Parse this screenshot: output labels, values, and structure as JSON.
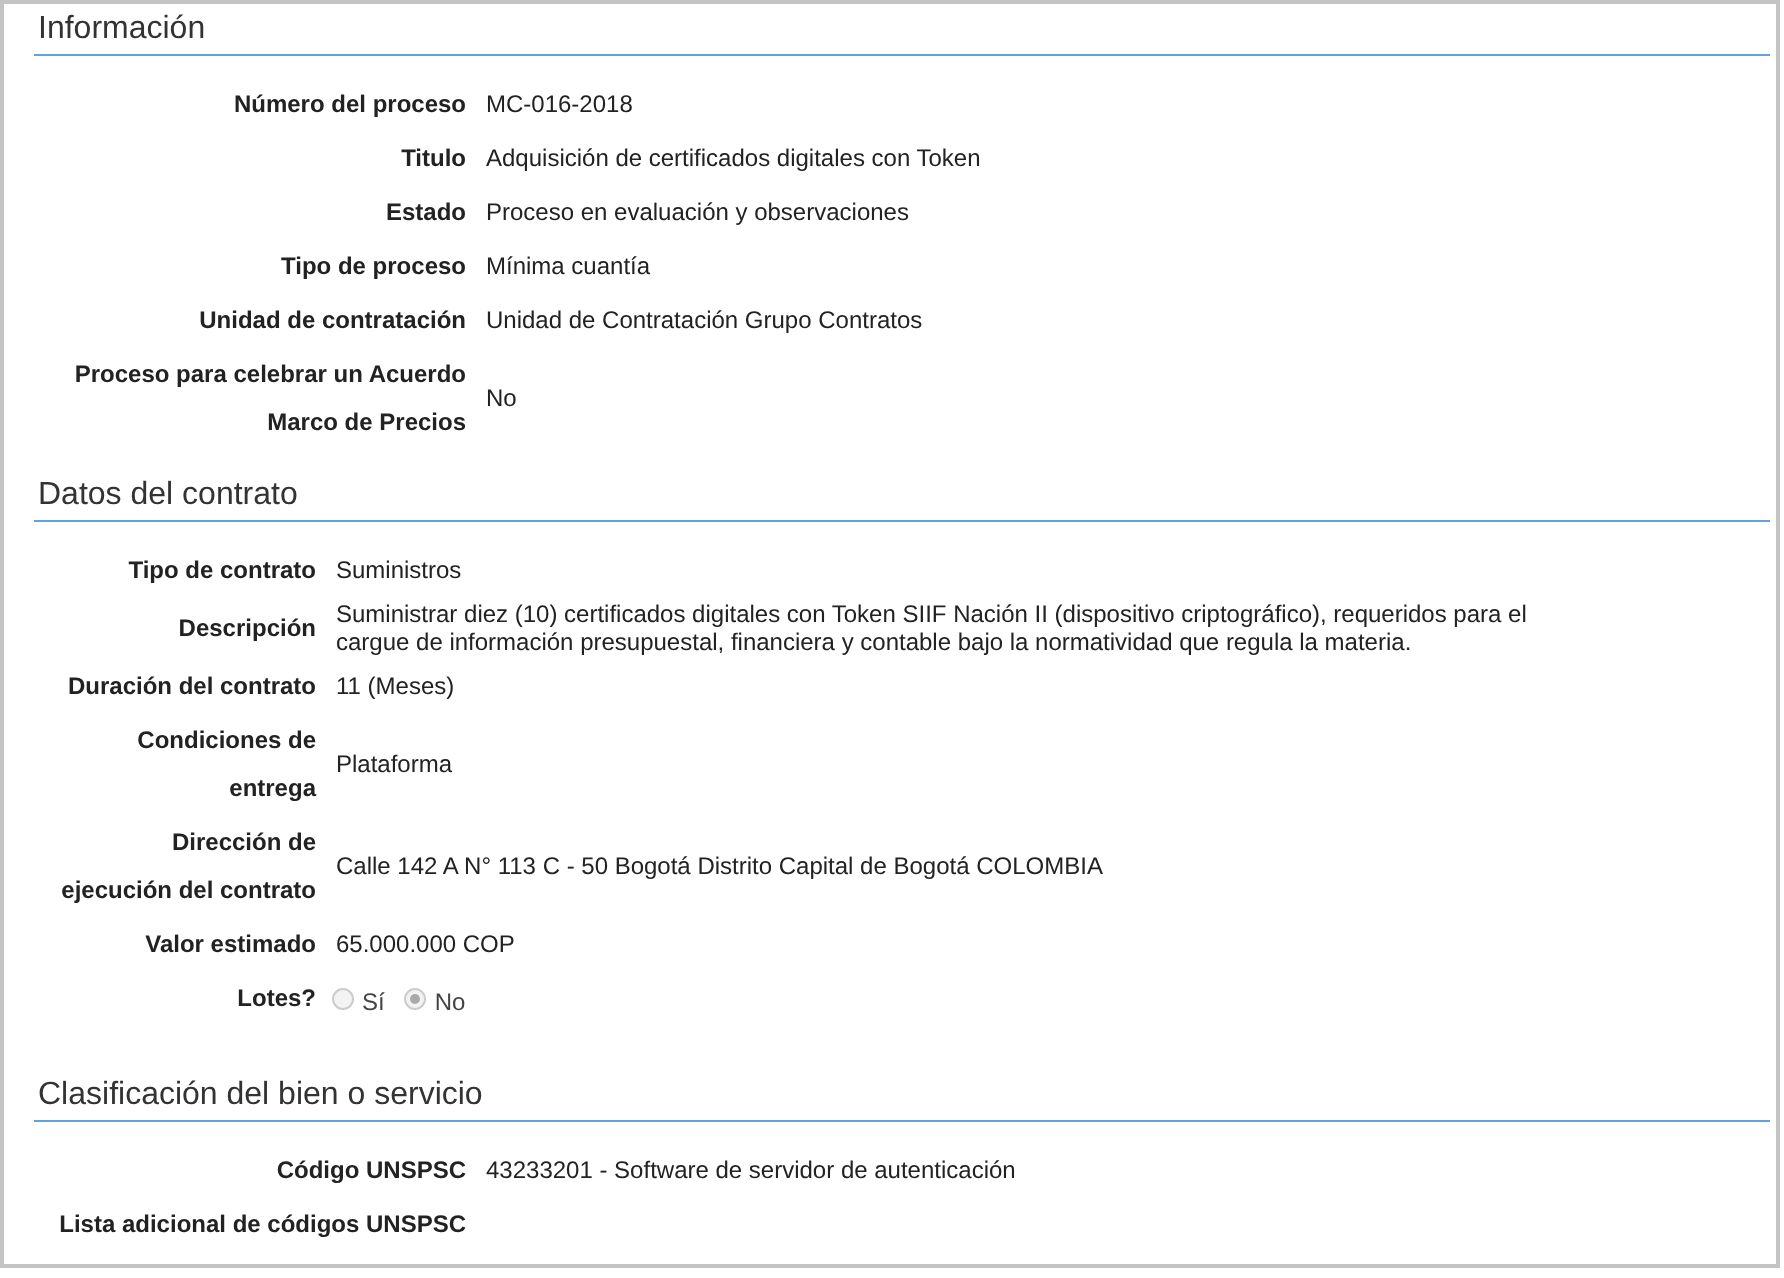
{
  "sections": [
    {
      "title": "Información",
      "fields": [
        {
          "label": "Número del proceso",
          "value": "MC-016-2018"
        },
        {
          "label": "Titulo",
          "value": "Adquisición de certificados digitales con Token"
        },
        {
          "label": "Estado",
          "value": "Proceso en evaluación y observaciones"
        },
        {
          "label": "Tipo de proceso",
          "value": "Mínima cuantía"
        },
        {
          "label": "Unidad de contratación",
          "value": "Unidad de Contratación Grupo Contratos"
        },
        {
          "label": "Proceso para celebrar un Acuerdo Marco de Precios",
          "value": "No"
        }
      ]
    },
    {
      "title": "Datos del contrato",
      "fields": [
        {
          "label": "Tipo de contrato",
          "value": "Suministros"
        },
        {
          "label": "Descripción",
          "value": "Suministrar diez (10) certificados digitales con Token SIIF Nación II (dispositivo criptográfico), requeridos para el cargue de información presupuestal, financiera y contable bajo la normatividad que regula la materia."
        },
        {
          "label": "Duración del contrato",
          "value": "11 (Meses)"
        },
        {
          "label": "Condiciones de entrega",
          "value": "Plataforma"
        },
        {
          "label": "Dirección de ejecución del contrato",
          "value": "Calle 142 A N° 113 C - 50 Bogotá Distrito Capital de Bogotá COLOMBIA"
        },
        {
          "label": "Valor estimado",
          "value": "65.000.000 COP"
        },
        {
          "label": "Lotes?",
          "kind": "radio",
          "options": [
            {
              "label": "Sí",
              "selected": false
            },
            {
              "label": "No",
              "selected": true
            }
          ]
        }
      ]
    },
    {
      "title": "Clasificación del bien o servicio",
      "fields": [
        {
          "label": "Código UNSPSC",
          "value": "43233201 - Software de servidor de autenticación"
        },
        {
          "label": "Lista adicional de códigos UNSPSC"
        }
      ]
    }
  ]
}
